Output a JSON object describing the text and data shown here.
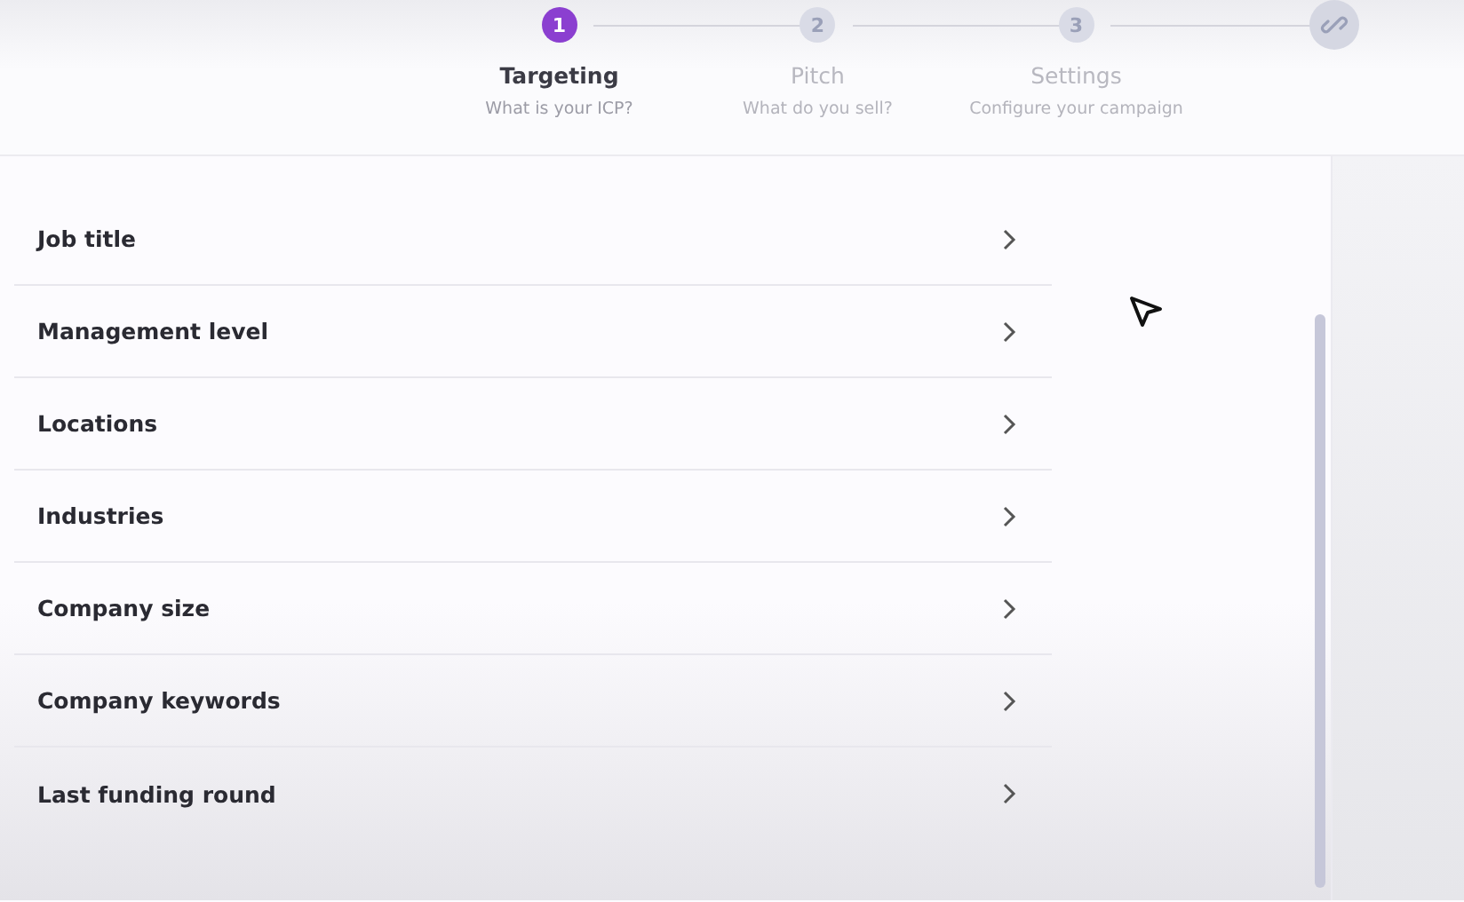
{
  "stepper": [
    {
      "kind": "number",
      "number": "1",
      "title": "Targeting",
      "subtitle": "What is your ICP?",
      "selected": true
    },
    {
      "kind": "number",
      "number": "2",
      "title": "Pitch",
      "subtitle": "What do you sell?",
      "selected": false
    },
    {
      "kind": "number",
      "number": "3",
      "title": "Settings",
      "subtitle": "Configure your campaign",
      "selected": false
    },
    {
      "kind": "icon",
      "selected": false
    }
  ],
  "filters": [
    {
      "label": "Job title"
    },
    {
      "label": "Management level"
    },
    {
      "label": "Locations"
    },
    {
      "label": "Industries"
    },
    {
      "label": "Company size"
    },
    {
      "label": "Company keywords"
    },
    {
      "label": "Last funding round"
    }
  ]
}
